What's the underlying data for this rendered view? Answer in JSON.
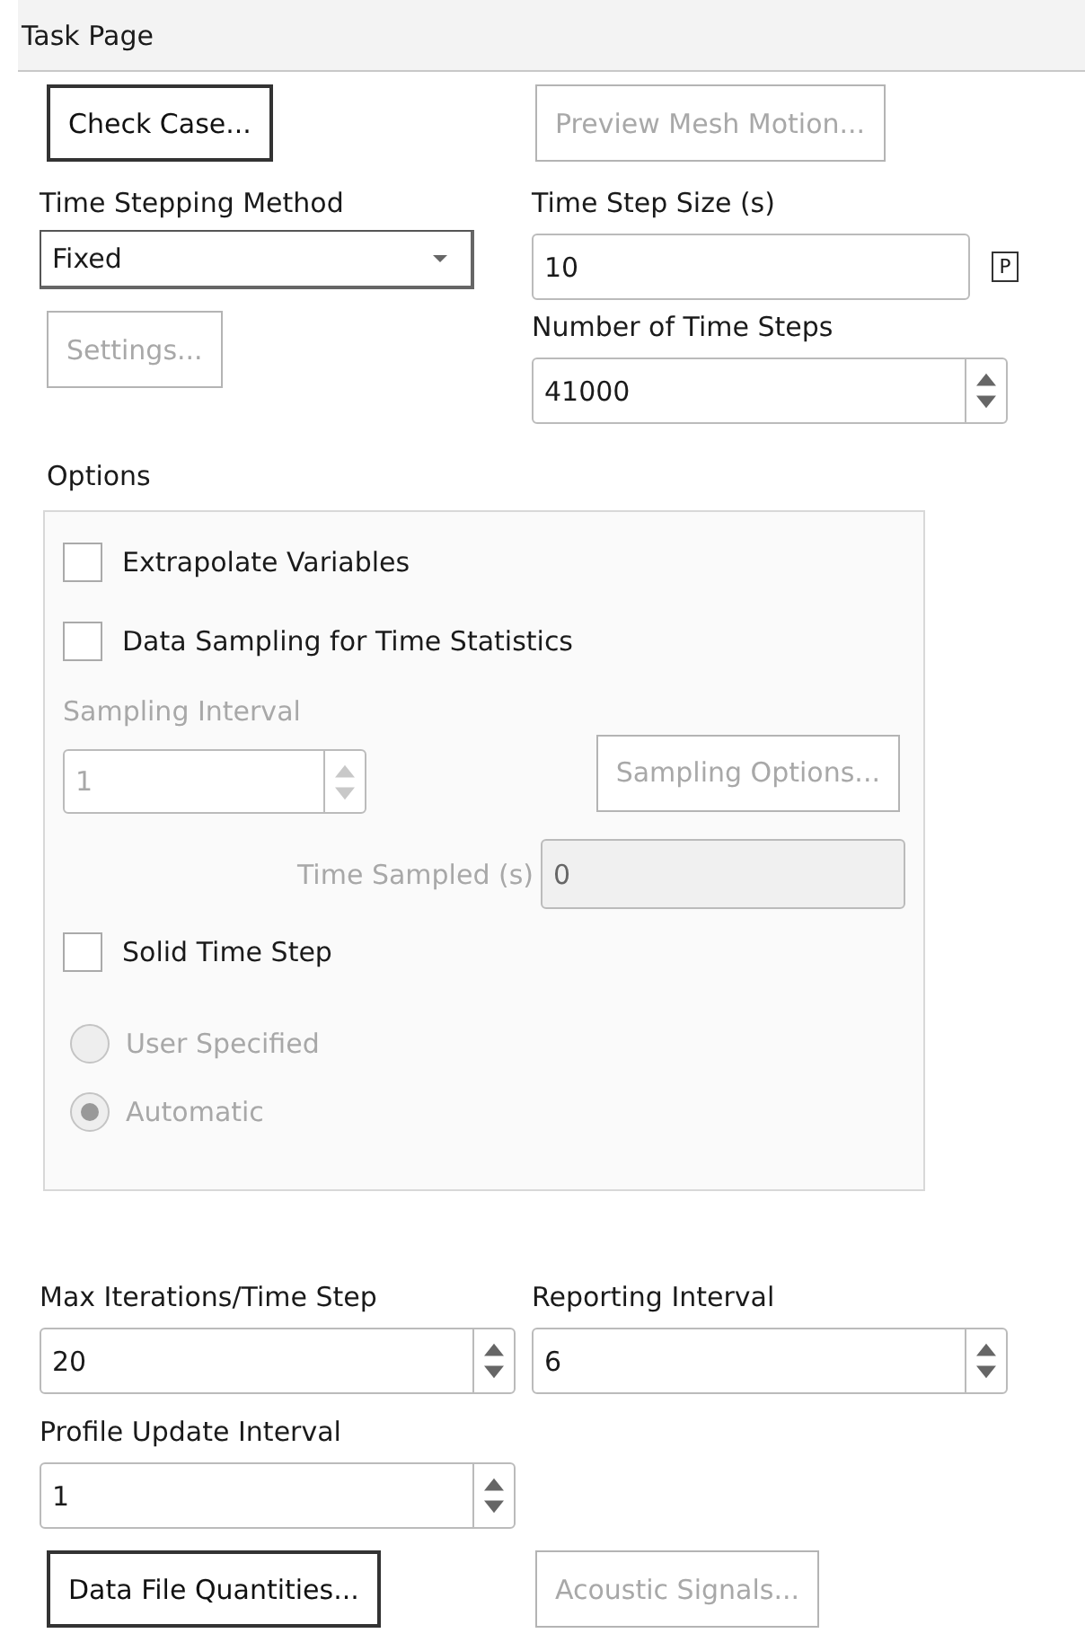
{
  "task_page": {
    "title": "Task Page"
  },
  "top_buttons": [
    {
      "label": "Check Case...",
      "disabled": false
    },
    {
      "label": "Preview Mesh Motion...",
      "disabled": true
    }
  ],
  "time_stepping_method": {
    "label": "Time Stepping Method",
    "value": "Fixed"
  },
  "settings_button": {
    "label": "Settings...",
    "disabled": true
  },
  "time_step_size": {
    "label": "Time Step Size (s)",
    "value": "10",
    "parameter_button": "P"
  },
  "number_of_time_steps": {
    "label": "Number of Time Steps",
    "value": "41000"
  },
  "options": {
    "title": "Options",
    "checkboxes": [
      {
        "label": "Extrapolate Variables",
        "checked": false
      },
      {
        "label": "Data Sampling for Time Statistics",
        "checked": false
      }
    ],
    "sampling_interval": {
      "label": "Sampling Interval",
      "value": "1",
      "disabled": true
    },
    "sampling_options_button": {
      "label": "Sampling Options...",
      "disabled": true
    },
    "time_sampled": {
      "label": "Time Sampled (s)",
      "value": "0",
      "disabled": true
    },
    "solid_time_step": {
      "label": "Solid Time Step",
      "checked": false
    },
    "solid_time_step_mode": {
      "disabled": true,
      "items": [
        {
          "label": "User Specified",
          "selected": false
        },
        {
          "label": "Automatic",
          "selected": true
        }
      ]
    }
  },
  "max_iterations": {
    "label": "Max Iterations/Time Step",
    "value": "20"
  },
  "reporting_interval": {
    "label": "Reporting Interval",
    "value": "6"
  },
  "profile_update_interval": {
    "label": "Profile Update Interval",
    "value": "1"
  },
  "bottom_buttons": [
    {
      "label": "Data File Quantities...",
      "disabled": false
    },
    {
      "label": "Acoustic Signals...",
      "disabled": true
    }
  ]
}
